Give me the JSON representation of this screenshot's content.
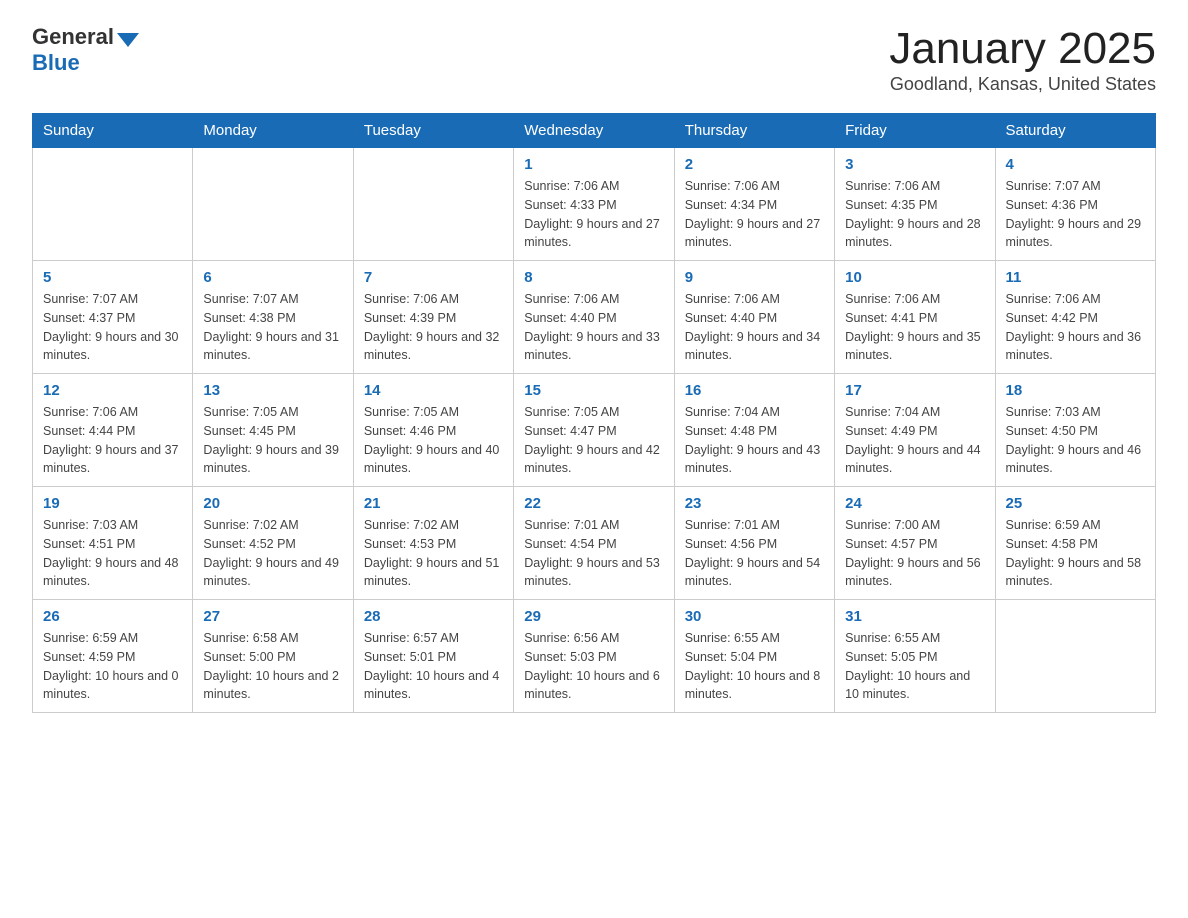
{
  "header": {
    "logo_general": "General",
    "logo_blue": "Blue",
    "month_title": "January 2025",
    "location": "Goodland, Kansas, United States"
  },
  "calendar": {
    "days_of_week": [
      "Sunday",
      "Monday",
      "Tuesday",
      "Wednesday",
      "Thursday",
      "Friday",
      "Saturday"
    ],
    "weeks": [
      [
        {
          "day": "",
          "info": ""
        },
        {
          "day": "",
          "info": ""
        },
        {
          "day": "",
          "info": ""
        },
        {
          "day": "1",
          "info": "Sunrise: 7:06 AM\nSunset: 4:33 PM\nDaylight: 9 hours and 27 minutes."
        },
        {
          "day": "2",
          "info": "Sunrise: 7:06 AM\nSunset: 4:34 PM\nDaylight: 9 hours and 27 minutes."
        },
        {
          "day": "3",
          "info": "Sunrise: 7:06 AM\nSunset: 4:35 PM\nDaylight: 9 hours and 28 minutes."
        },
        {
          "day": "4",
          "info": "Sunrise: 7:07 AM\nSunset: 4:36 PM\nDaylight: 9 hours and 29 minutes."
        }
      ],
      [
        {
          "day": "5",
          "info": "Sunrise: 7:07 AM\nSunset: 4:37 PM\nDaylight: 9 hours and 30 minutes."
        },
        {
          "day": "6",
          "info": "Sunrise: 7:07 AM\nSunset: 4:38 PM\nDaylight: 9 hours and 31 minutes."
        },
        {
          "day": "7",
          "info": "Sunrise: 7:06 AM\nSunset: 4:39 PM\nDaylight: 9 hours and 32 minutes."
        },
        {
          "day": "8",
          "info": "Sunrise: 7:06 AM\nSunset: 4:40 PM\nDaylight: 9 hours and 33 minutes."
        },
        {
          "day": "9",
          "info": "Sunrise: 7:06 AM\nSunset: 4:40 PM\nDaylight: 9 hours and 34 minutes."
        },
        {
          "day": "10",
          "info": "Sunrise: 7:06 AM\nSunset: 4:41 PM\nDaylight: 9 hours and 35 minutes."
        },
        {
          "day": "11",
          "info": "Sunrise: 7:06 AM\nSunset: 4:42 PM\nDaylight: 9 hours and 36 minutes."
        }
      ],
      [
        {
          "day": "12",
          "info": "Sunrise: 7:06 AM\nSunset: 4:44 PM\nDaylight: 9 hours and 37 minutes."
        },
        {
          "day": "13",
          "info": "Sunrise: 7:05 AM\nSunset: 4:45 PM\nDaylight: 9 hours and 39 minutes."
        },
        {
          "day": "14",
          "info": "Sunrise: 7:05 AM\nSunset: 4:46 PM\nDaylight: 9 hours and 40 minutes."
        },
        {
          "day": "15",
          "info": "Sunrise: 7:05 AM\nSunset: 4:47 PM\nDaylight: 9 hours and 42 minutes."
        },
        {
          "day": "16",
          "info": "Sunrise: 7:04 AM\nSunset: 4:48 PM\nDaylight: 9 hours and 43 minutes."
        },
        {
          "day": "17",
          "info": "Sunrise: 7:04 AM\nSunset: 4:49 PM\nDaylight: 9 hours and 44 minutes."
        },
        {
          "day": "18",
          "info": "Sunrise: 7:03 AM\nSunset: 4:50 PM\nDaylight: 9 hours and 46 minutes."
        }
      ],
      [
        {
          "day": "19",
          "info": "Sunrise: 7:03 AM\nSunset: 4:51 PM\nDaylight: 9 hours and 48 minutes."
        },
        {
          "day": "20",
          "info": "Sunrise: 7:02 AM\nSunset: 4:52 PM\nDaylight: 9 hours and 49 minutes."
        },
        {
          "day": "21",
          "info": "Sunrise: 7:02 AM\nSunset: 4:53 PM\nDaylight: 9 hours and 51 minutes."
        },
        {
          "day": "22",
          "info": "Sunrise: 7:01 AM\nSunset: 4:54 PM\nDaylight: 9 hours and 53 minutes."
        },
        {
          "day": "23",
          "info": "Sunrise: 7:01 AM\nSunset: 4:56 PM\nDaylight: 9 hours and 54 minutes."
        },
        {
          "day": "24",
          "info": "Sunrise: 7:00 AM\nSunset: 4:57 PM\nDaylight: 9 hours and 56 minutes."
        },
        {
          "day": "25",
          "info": "Sunrise: 6:59 AM\nSunset: 4:58 PM\nDaylight: 9 hours and 58 minutes."
        }
      ],
      [
        {
          "day": "26",
          "info": "Sunrise: 6:59 AM\nSunset: 4:59 PM\nDaylight: 10 hours and 0 minutes."
        },
        {
          "day": "27",
          "info": "Sunrise: 6:58 AM\nSunset: 5:00 PM\nDaylight: 10 hours and 2 minutes."
        },
        {
          "day": "28",
          "info": "Sunrise: 6:57 AM\nSunset: 5:01 PM\nDaylight: 10 hours and 4 minutes."
        },
        {
          "day": "29",
          "info": "Sunrise: 6:56 AM\nSunset: 5:03 PM\nDaylight: 10 hours and 6 minutes."
        },
        {
          "day": "30",
          "info": "Sunrise: 6:55 AM\nSunset: 5:04 PM\nDaylight: 10 hours and 8 minutes."
        },
        {
          "day": "31",
          "info": "Sunrise: 6:55 AM\nSunset: 5:05 PM\nDaylight: 10 hours and 10 minutes."
        },
        {
          "day": "",
          "info": ""
        }
      ]
    ]
  }
}
